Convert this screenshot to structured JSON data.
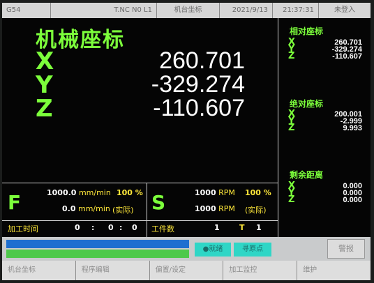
{
  "topbar": {
    "mode": "G54",
    "program": "T.NC N0 L1",
    "view": "机台坐标",
    "date": "2021/9/13",
    "time": "21:37:31",
    "login": "未登入"
  },
  "machine": {
    "title": "机械座标",
    "x_label": "X",
    "y_label": "Y",
    "z_label": "Z",
    "x": "260.701",
    "y": "-329.274",
    "z": "-110.607"
  },
  "relative": {
    "title": "相对座标",
    "x": "260.701",
    "y": "-329.274",
    "z": "-110.607"
  },
  "absolute": {
    "title": "绝对座标",
    "x": "200.001",
    "y": "-2.999",
    "z": "9.993"
  },
  "remaining": {
    "title": "剩余距离",
    "x": "0.000",
    "y": "0.000",
    "z": "0.000"
  },
  "feed": {
    "label": "F",
    "set_value": "1000.0",
    "actual_value": "0.0",
    "unit": "mm/min",
    "override": "100 %",
    "actual_label": "(实际)"
  },
  "spindle": {
    "label": "S",
    "set_value": "1000",
    "actual_value": "1000",
    "unit": "RPM",
    "override": "100 %",
    "actual_label": "(实际)"
  },
  "process": {
    "time_label": "加工时间",
    "hours": "0",
    "sep1": ":",
    "minutes": "0",
    "sep2": ":",
    "seconds": "0",
    "workpiece_label": "工件数",
    "workpiece_count": "1",
    "tool_label": "T",
    "tool_number": "1"
  },
  "status": {
    "ready_label": "●就绪",
    "home_label": "寻原点",
    "alarm_label": "警报",
    "progress_blue": 1.0,
    "progress_green": 1.0
  },
  "softkeys": [
    "机台坐标",
    "程序编辑",
    "偏置/设定",
    "加工监控",
    "维护"
  ],
  "colors": {
    "accent_green": "#7cff3b",
    "unit_yellow": "#ffe83a",
    "ready_teal": "#2fd6c6"
  }
}
